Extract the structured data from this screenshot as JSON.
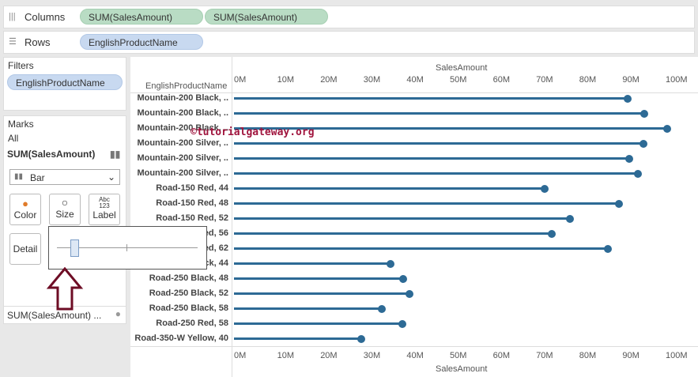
{
  "shelves": {
    "columns_label": "Columns",
    "columns_pills": [
      "SUM(SalesAmount)",
      "SUM(SalesAmount)"
    ],
    "rows_label": "Rows",
    "rows_pills": [
      "EnglishProductName"
    ]
  },
  "filters": {
    "title": "Filters",
    "pills": [
      "EnglishProductName"
    ]
  },
  "marks": {
    "title": "Marks",
    "all": "All",
    "measure": "SUM(SalesAmount)",
    "mark_type": "Bar",
    "buttons": {
      "color": "Color",
      "size": "Size",
      "label": "Label",
      "label_icon": "Abc\n123",
      "detail": "Detail"
    },
    "footer": "SUM(SalesAmount) ..."
  },
  "size_slider": {
    "value": 0.12
  },
  "watermark": "©tutorialgateway.org",
  "chart_data": {
    "type": "lollipop",
    "title": "",
    "row_header": "EnglishProductName",
    "xlabel": "SalesAmount",
    "xlim": [
      0,
      100
    ],
    "x_ticks": [
      "0M",
      "10M",
      "20M",
      "30M",
      "40M",
      "50M",
      "60M",
      "70M",
      "80M",
      "90M",
      "100M"
    ],
    "categories": [
      "Mountain-200 Black, ..",
      "Mountain-200 Black, ..",
      "Mountain-200 Black, ..",
      "Mountain-200 Silver, ..",
      "Mountain-200 Silver, ..",
      "Mountain-200 Silver, ..",
      "Road-150 Red, 44",
      "Road-150 Red, 48",
      "Road-150 Red, 52",
      "Road-150 Red, 56",
      "Road-150 Red, 62",
      "Road-250 Black, 44",
      "Road-250 Black, 48",
      "Road-250 Black, 52",
      "Road-250 Black, 58",
      "Road-250 Red, 58",
      "Road-350-W Yellow, 40"
    ],
    "values": [
      91.2,
      95.1,
      100.4,
      94.9,
      91.6,
      93.6,
      72.0,
      89.2,
      77.8,
      73.6,
      86.6,
      36.3,
      39.2,
      40.7,
      34.2,
      39.0,
      29.5
    ],
    "color": "#2d6a95"
  }
}
